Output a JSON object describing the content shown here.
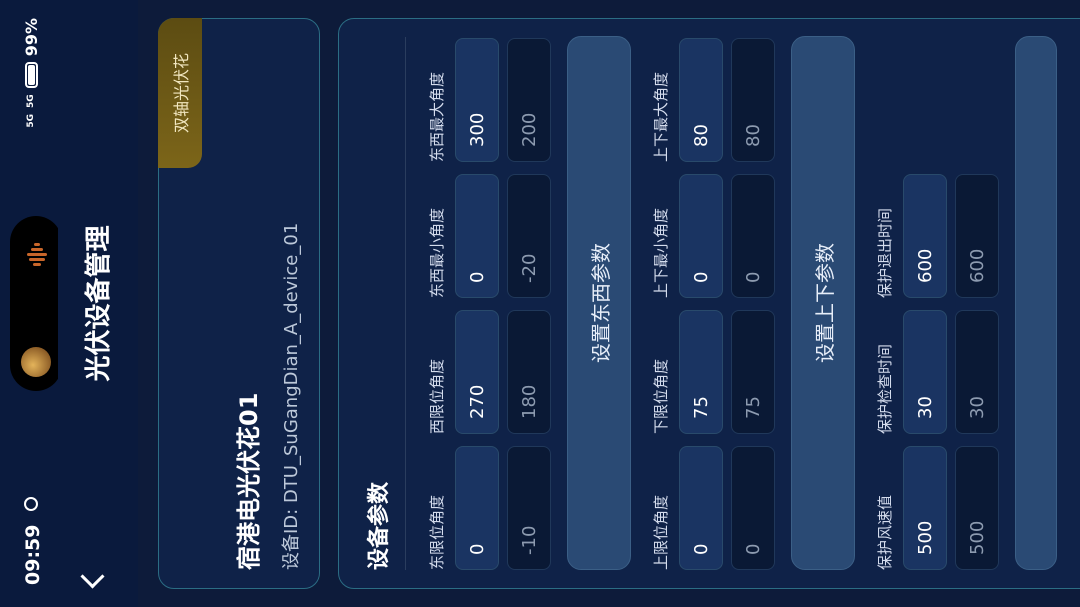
{
  "status": {
    "time": "09:59",
    "battery": "99%",
    "network": "5G"
  },
  "header": {
    "title": "光伏设备管理"
  },
  "device": {
    "name": "宿港电光伏花01",
    "id_label": "设备ID: DTU_SuGangDian_A_device_01",
    "tag": "双轴光伏花"
  },
  "params": {
    "title": "设备参数",
    "east_west": [
      {
        "label": "东限位角度",
        "value": "0",
        "current": "-10"
      },
      {
        "label": "西限位角度",
        "value": "270",
        "current": "180"
      },
      {
        "label": "东西最小角度",
        "value": "0",
        "current": "-20"
      },
      {
        "label": "东西最大角度",
        "value": "300",
        "current": "200"
      }
    ],
    "ew_button": "设置东西参数",
    "up_down": [
      {
        "label": "上限位角度",
        "value": "0",
        "current": "0"
      },
      {
        "label": "下限位角度",
        "value": "75",
        "current": "75"
      },
      {
        "label": "上下最小角度",
        "value": "0",
        "current": "0"
      },
      {
        "label": "上下最大角度",
        "value": "80",
        "current": "80"
      }
    ],
    "ud_button": "设置上下参数",
    "protect": [
      {
        "label": "保护风速值",
        "value": "500",
        "current": "500"
      },
      {
        "label": "保护检查时间",
        "value": "30",
        "current": "30"
      },
      {
        "label": "保护退出时间",
        "value": "600",
        "current": "600"
      }
    ]
  }
}
